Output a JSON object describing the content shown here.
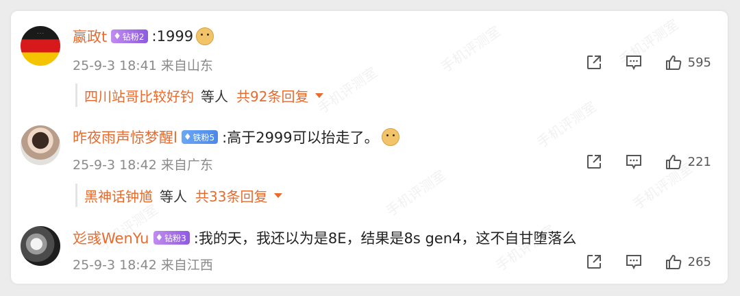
{
  "colors": {
    "accent": "#e86a2c",
    "meta": "#8a8a8a",
    "background": "#ffffff"
  },
  "watermark": "手机评测室",
  "comments": [
    {
      "username": "嬴政t",
      "badge": {
        "label": "钻粉2",
        "icon": "diamond-icon"
      },
      "text": ":1999",
      "emoji": "doge-emoji",
      "date": "25-9-3 18:41 来自山东",
      "likes": "595",
      "replies": {
        "who": "四川站哥比较好钓",
        "etc": "等人",
        "total": "共92条回复"
      }
    },
    {
      "username": "昨夜雨声惊梦醒l",
      "badge": {
        "label": "铁粉5",
        "icon": "diamond-icon"
      },
      "text": ":高于2999可以抬走了。",
      "emoji": "doge-emoji",
      "date": "25-9-3 18:42 来自广东",
      "likes": "221",
      "replies": {
        "who": "黑神话钟馗",
        "etc": "等人",
        "total": "共33条回复"
      }
    },
    {
      "username": "彣彧WenYu",
      "badge": {
        "label": "钻粉3",
        "icon": "diamond-icon"
      },
      "text": ":我的天，我还以为是8E，结果是8s gen4，这不自甘堕落么",
      "date": "25-9-3 18:42 来自江西",
      "likes": "265"
    }
  ]
}
